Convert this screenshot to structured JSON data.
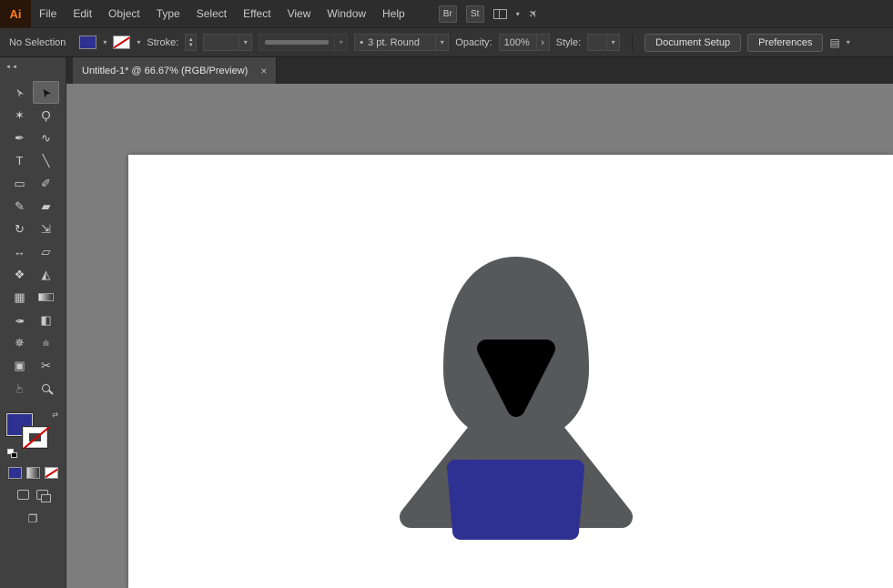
{
  "menubar": {
    "logo_text": "Ai",
    "items": [
      "File",
      "Edit",
      "Object",
      "Type",
      "Select",
      "Effect",
      "View",
      "Window",
      "Help"
    ],
    "bridge_badge": "Br",
    "stock_badge": "St",
    "gpu_glyph": "✈"
  },
  "control_bar": {
    "selection_status": "No Selection",
    "stroke_label": "Stroke:",
    "stepper_up": "▲",
    "stepper_down": "▼",
    "brush_dot": "•",
    "brush_value": "3 pt. Round",
    "opacity_label": "Opacity:",
    "opacity_value": "100%",
    "opacity_flyout": "›",
    "style_label": "Style:",
    "document_setup_button": "Document Setup",
    "preferences_button": "Preferences",
    "chevron": "▾",
    "touch_icon_glyph": "▤"
  },
  "tab_bar": {
    "active_tab": "Untitled-1* @ 66.67% (RGB/Preview)",
    "close_glyph": "×"
  },
  "toolbar": {
    "collapse_glyph": "◄◄",
    "swap_glyph": "⇄",
    "screen_mode_glyph": "❐",
    "tools": [
      {
        "name": "direct-selection",
        "glyph": "➢"
      },
      {
        "name": "selection",
        "glyph": "➤",
        "active": true
      },
      {
        "name": "magic-wand",
        "glyph": "✶"
      },
      {
        "name": "lasso",
        "glyph": "Ϙ"
      },
      {
        "name": "pen",
        "glyph": "✒"
      },
      {
        "name": "curvature",
        "glyph": "∿"
      },
      {
        "name": "type",
        "glyph": "T"
      },
      {
        "name": "line-segment",
        "glyph": "╲"
      },
      {
        "name": "rectangle",
        "glyph": "▭"
      },
      {
        "name": "paintbrush",
        "glyph": "✐"
      },
      {
        "name": "pencil",
        "glyph": "✎"
      },
      {
        "name": "eraser",
        "glyph": "▰"
      },
      {
        "name": "rotate",
        "glyph": "↻"
      },
      {
        "name": "scale",
        "glyph": "⇲"
      },
      {
        "name": "width",
        "glyph": "↔"
      },
      {
        "name": "free-transform",
        "glyph": "▱"
      },
      {
        "name": "shape-builder",
        "glyph": "❖"
      },
      {
        "name": "perspective-grid",
        "glyph": "◭"
      },
      {
        "name": "mesh",
        "glyph": "▦"
      },
      {
        "name": "gradient",
        "glyph": ""
      },
      {
        "name": "eyedropper",
        "glyph": "✒"
      },
      {
        "name": "blend",
        "glyph": "◧"
      },
      {
        "name": "symbol-sprayer",
        "glyph": "✵"
      },
      {
        "name": "column-graph",
        "glyph": "ılı"
      },
      {
        "name": "artboard",
        "glyph": "▣"
      },
      {
        "name": "slice",
        "glyph": "✂"
      },
      {
        "name": "hand",
        "glyph": "☞"
      },
      {
        "name": "zoom",
        "glyph": ""
      }
    ]
  },
  "colors": {
    "fill_blue": "#2e3192",
    "canvas_gray": "#7d7d7d",
    "artboard_white": "#ffffff",
    "hood_gray": "#57585a",
    "face_black": "#000000",
    "body_blue": "#2e3192"
  }
}
